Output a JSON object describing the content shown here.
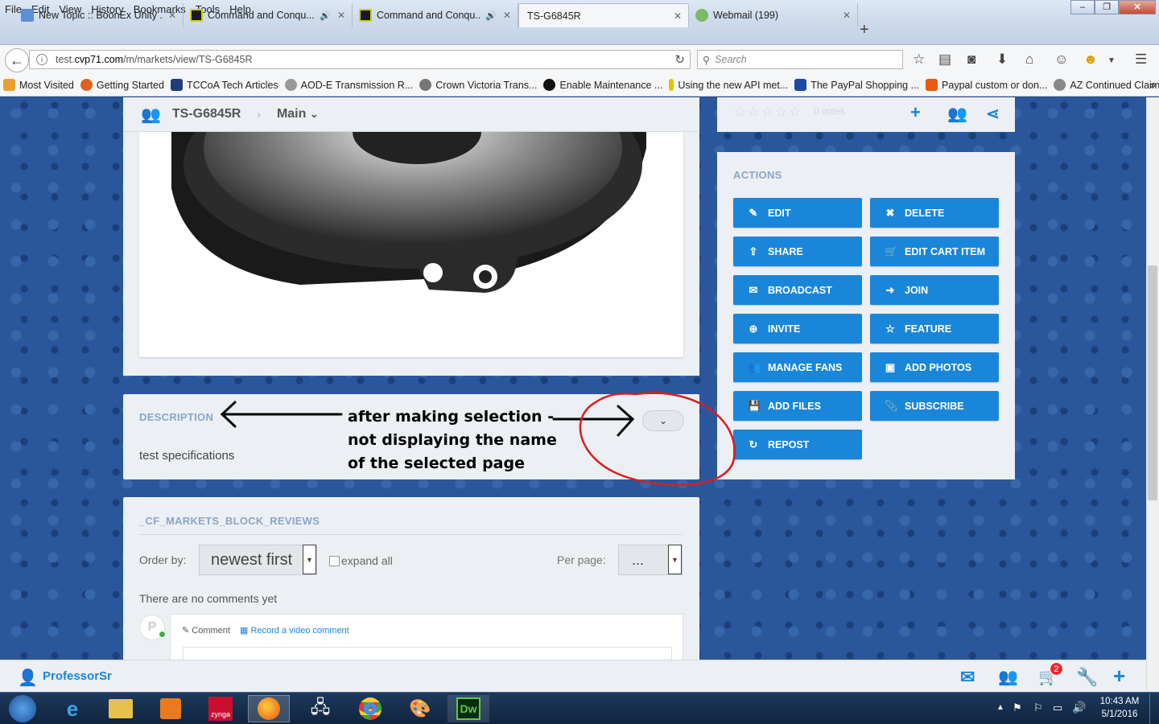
{
  "menu": [
    "File",
    "Edit",
    "View",
    "History",
    "Bookmarks",
    "Tools",
    "Help"
  ],
  "tabs": [
    {
      "title": "New Topic :: BoonEx Unity ...",
      "icon": "boonex-icon",
      "audio": false
    },
    {
      "title": "Command and Conqu...",
      "icon": "cnc-icon",
      "audio": true
    },
    {
      "title": "Command and Conqu...",
      "icon": "cnc-icon",
      "audio": true
    },
    {
      "title": "TS-G6845R",
      "icon": "",
      "audio": false
    },
    {
      "title": "Webmail (199)",
      "icon": "webmail-icon",
      "audio": false
    }
  ],
  "url": {
    "prefix": "test.",
    "domain": "cvp71.com",
    "path": "/m/markets/view/TS-G6845R"
  },
  "search_placeholder": "Search",
  "bookmarks": [
    "Most Visited",
    "Getting Started",
    "TCCoA Tech Articles",
    "AOD-E Transmission R...",
    "Crown Victoria Trans...",
    "Enable Maintenance ...",
    "Using the new API met...",
    "The PayPal Shopping ...",
    "Paypal custom or don...",
    "AZ Continued Claims: ..."
  ],
  "toolbar": {
    "title": "TS-G6845R",
    "main_label": "Main"
  },
  "rating": {
    "votes": "0 votes"
  },
  "actions": {
    "title": "ACTIONS",
    "buttons": [
      {
        "label": "EDIT",
        "icon": "edit-icon",
        "glyph": "✎"
      },
      {
        "label": "DELETE",
        "icon": "delete-icon",
        "glyph": "✖"
      },
      {
        "label": "SHARE",
        "icon": "share-icon",
        "glyph": "⇪"
      },
      {
        "label": "EDIT CART ITEM",
        "icon": "cart-icon",
        "glyph": "🛒"
      },
      {
        "label": "BROADCAST",
        "icon": "envelope-icon",
        "glyph": "✉"
      },
      {
        "label": "JOIN",
        "icon": "sign-in-icon",
        "glyph": "➜"
      },
      {
        "label": "INVITE",
        "icon": "plus-circle-icon",
        "glyph": "⊕"
      },
      {
        "label": "FEATURE",
        "icon": "star-icon",
        "glyph": "☆"
      },
      {
        "label": "MANAGE FANS",
        "icon": "users-icon",
        "glyph": "👥"
      },
      {
        "label": "ADD PHOTOS",
        "icon": "photo-icon",
        "glyph": "▣"
      },
      {
        "label": "ADD FILES",
        "icon": "save-icon",
        "glyph": "💾"
      },
      {
        "label": "SUBSCRIBE",
        "icon": "paperclip-icon",
        "glyph": "📎"
      },
      {
        "label": "REPOST",
        "icon": "repost-icon",
        "glyph": "↻"
      }
    ]
  },
  "description": {
    "title": "DESCRIPTION",
    "text": "test specifications"
  },
  "annotation": {
    "line1": "after making selection -",
    "line2": "not displaying the name",
    "line3": "of the selected page"
  },
  "reviews": {
    "title": "_CF_MARKETS_BLOCK_REVIEWS",
    "order_label": "Order by:",
    "order_value": "newest first",
    "expand_label": "expand all",
    "perpage_label": "Per page:",
    "perpage_value": "...",
    "empty_text": "There are no comments yet",
    "comment_tab": "Comment",
    "video_tab": "Record a video comment",
    "avatar_letter": "P"
  },
  "footer": {
    "username": "ProfessorSr",
    "cart_count": "2"
  },
  "clock": {
    "time": "10:43 AM",
    "date": "5/1/2016"
  },
  "colors": {
    "accent": "#1a86d9",
    "annotation_circle": "#d81e1e",
    "panel": "#eceff3"
  }
}
